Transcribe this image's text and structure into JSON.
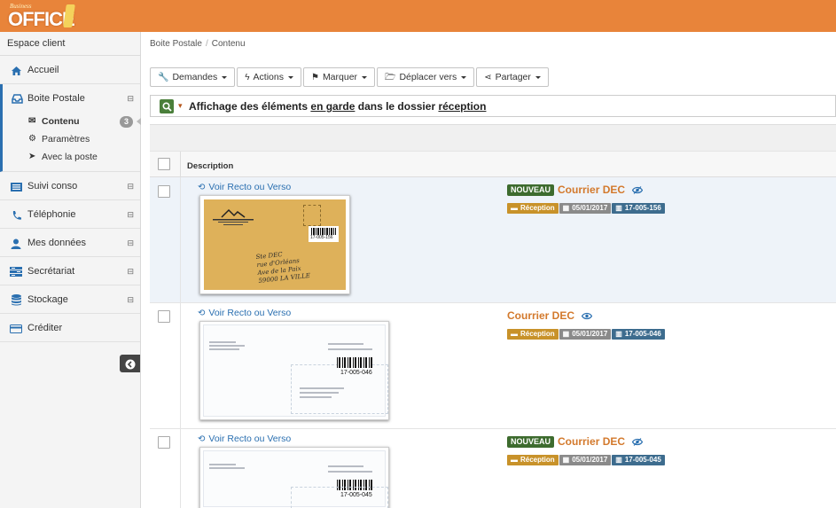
{
  "header": {
    "logo_small": "Business",
    "logo_big": "OFFICE"
  },
  "sidebar": {
    "header": "Espace client",
    "items": [
      {
        "label": "Accueil",
        "icon": "home-icon"
      },
      {
        "label": "Boite Postale",
        "icon": "inbox-icon"
      },
      {
        "label": "Suivi conso",
        "icon": "list-icon"
      },
      {
        "label": "Téléphonie",
        "icon": "phone-icon"
      },
      {
        "label": "Mes données",
        "icon": "user-icon"
      },
      {
        "label": "Secrétariat",
        "icon": "secretariat-icon"
      },
      {
        "label": "Stockage",
        "icon": "database-icon"
      },
      {
        "label": "Créditer",
        "icon": "credit-card-icon"
      }
    ],
    "subitems": [
      {
        "label": "Contenu",
        "badge": "3"
      },
      {
        "label": "Paramètres"
      },
      {
        "label": "Avec la poste"
      }
    ],
    "toggle_glyph": "⊟",
    "collapse_glyph": "➜"
  },
  "breadcrumb": {
    "root": "Boite Postale",
    "sep": "/",
    "current": "Contenu"
  },
  "toolbar": {
    "demandes": "Demandes",
    "actions": "Actions",
    "marquer": "Marquer",
    "deplacer": "Déplacer vers",
    "partager": "Partager"
  },
  "filter": {
    "text_a": "Affichage des éléments ",
    "link_a": "en garde",
    "text_b": " dans le dossier ",
    "link_b": "réception"
  },
  "table": {
    "col_description": "Description"
  },
  "rows": [
    {
      "recto_label": "Voir Recto ou Verso",
      "nouveau": "NOUVEAU",
      "title": "Courrier DEC",
      "folder": "Réception",
      "date": "05/01/2017",
      "ref": "17-005-156",
      "barcode": "17-005-156",
      "is_new": true
    },
    {
      "recto_label": "Voir Recto ou Verso",
      "nouveau": "",
      "title": "Courrier DEC",
      "folder": "Réception",
      "date": "05/01/2017",
      "ref": "17-005-046",
      "barcode": "17-005-046",
      "is_new": false
    },
    {
      "recto_label": "Voir Recto ou Verso",
      "nouveau": "NOUVEAU",
      "title": "Courrier DEC",
      "folder": "Réception",
      "date": "05/01/2017",
      "ref": "17-005-045",
      "barcode": "17-005-045",
      "is_new": true
    }
  ],
  "envelope_handwriting": [
    "Ste DEC",
    "rue d'Orléans",
    "Ave de la Paix",
    "59000 LA VILLE"
  ],
  "colors": {
    "topbar": "#e8843a",
    "accent_blue": "#2a6fb0",
    "title_orange": "#d3792c",
    "nouveau_green": "#3d6b2e",
    "tag_reception": "#c8922a",
    "tag_date": "#8a8a8a",
    "tag_ref": "#3d6c8e"
  }
}
